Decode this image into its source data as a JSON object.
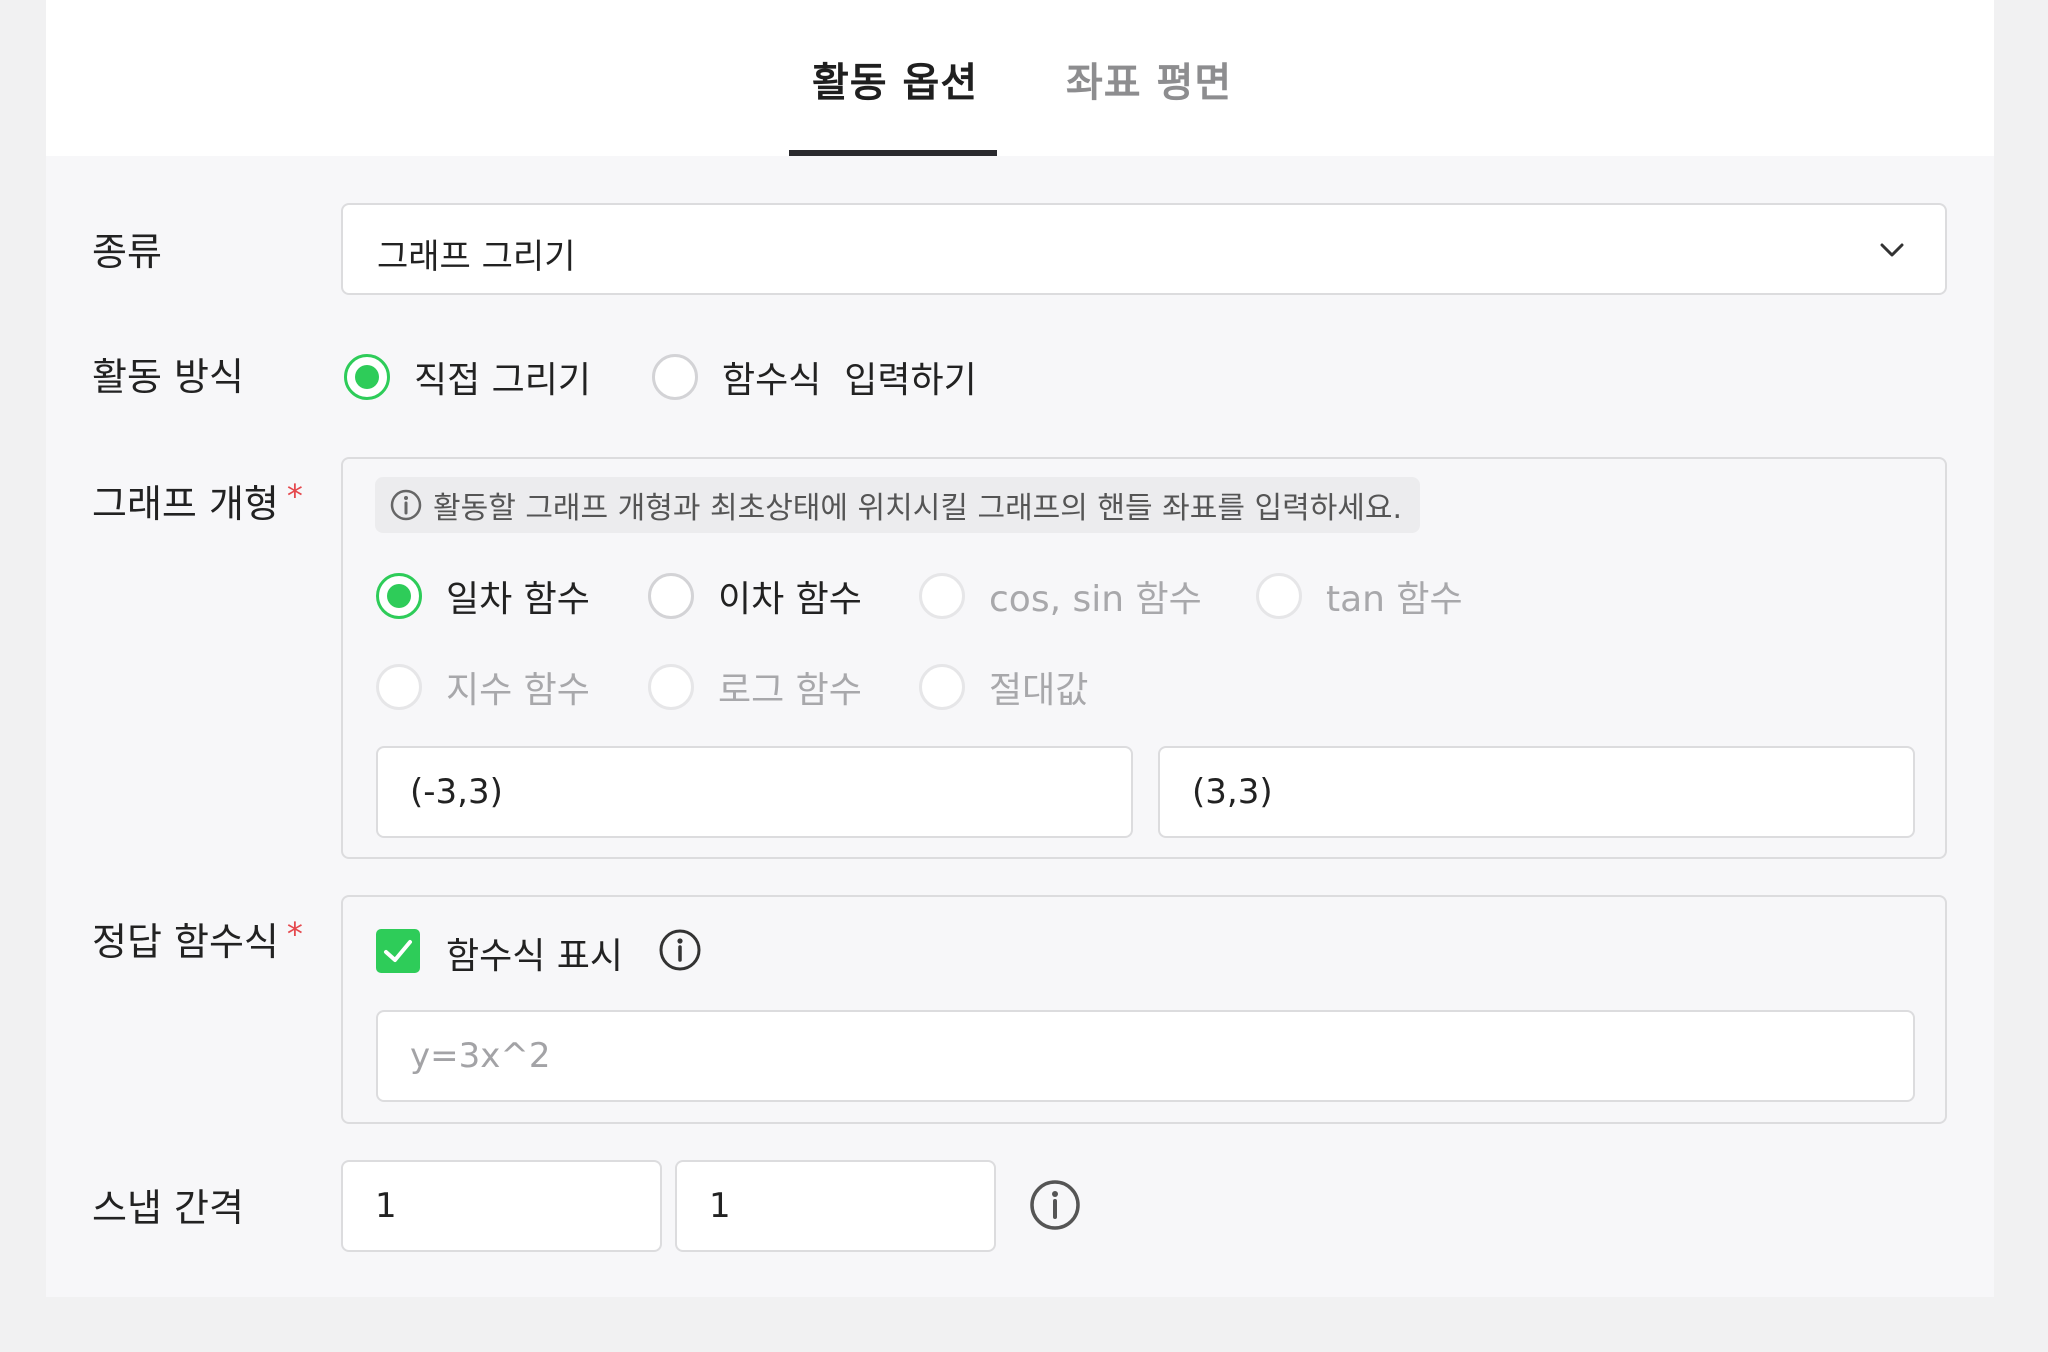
{
  "tabs": {
    "activity_options": "활동 옵션",
    "coordinate_plane": "좌표 평면"
  },
  "type_row": {
    "label": "종류",
    "selected": "그래프 그리기"
  },
  "method_row": {
    "label": "활동 방식",
    "options": [
      {
        "label": "직접 그리기",
        "selected": true
      },
      {
        "label": "함수식  입력하기",
        "selected": false
      }
    ]
  },
  "shape_row": {
    "label": "그래프 개형",
    "required_mark": "*",
    "hint": "활동할 그래프 개형과 최초상태에 위치시킬 그래프의 핸들 좌표를 입력하세요.",
    "options": [
      {
        "label": "일차 함수",
        "selected": true,
        "disabled": false
      },
      {
        "label": "이차 함수",
        "selected": false,
        "disabled": false
      },
      {
        "label": "cos, sin 함수",
        "selected": false,
        "disabled": true
      },
      {
        "label": "tan 함수",
        "selected": false,
        "disabled": true
      },
      {
        "label": "지수 함수",
        "selected": false,
        "disabled": true
      },
      {
        "label": "로그 함수",
        "selected": false,
        "disabled": true
      },
      {
        "label": "절대값",
        "selected": false,
        "disabled": true
      }
    ],
    "handle_1": "(-3,3)",
    "handle_2": "(3,3)"
  },
  "answer_row": {
    "label": "정답 함수식",
    "required_mark": "*",
    "show_formula_label": "함수식 표시",
    "show_formula_checked": true,
    "formula_placeholder": "y=3x^2"
  },
  "snap_row": {
    "label": "스냅 간격",
    "x": "1",
    "y": "1"
  },
  "colors": {
    "accent_green": "#2ecc59",
    "required_red": "#e5484d"
  }
}
